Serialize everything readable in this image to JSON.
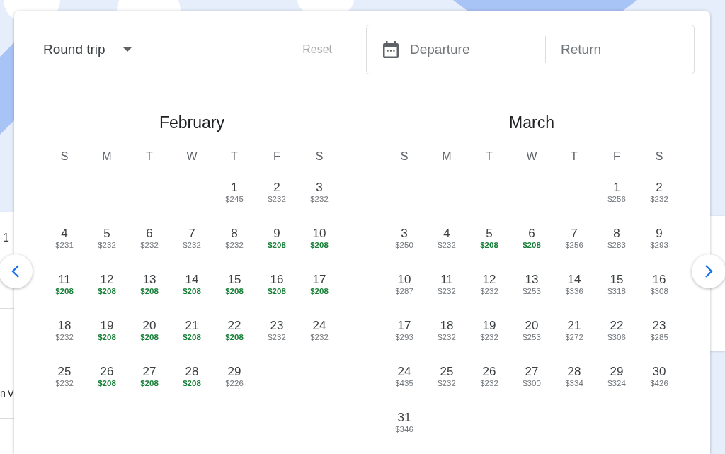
{
  "background": {
    "fragments": [
      "1",
      "n V"
    ]
  },
  "header": {
    "trip_type": "Round trip",
    "reset": {
      "label": "Reset",
      "disabled": true
    },
    "dates": {
      "departure_placeholder": "Departure",
      "return_placeholder": "Return"
    }
  },
  "months": [
    {
      "name": "February",
      "weekdays": [
        "S",
        "M",
        "T",
        "W",
        "T",
        "F",
        "S"
      ],
      "days": [
        {
          "kind": "blank"
        },
        {
          "kind": "blank"
        },
        {
          "kind": "blank"
        },
        {
          "kind": "blank"
        },
        {
          "kind": "day",
          "day": "1",
          "price": "$245",
          "lowest": false
        },
        {
          "kind": "day",
          "day": "2",
          "price": "$232",
          "lowest": false
        },
        {
          "kind": "day",
          "day": "3",
          "price": "$232",
          "lowest": false
        },
        {
          "kind": "day",
          "day": "4",
          "price": "$231",
          "lowest": false
        },
        {
          "kind": "day",
          "day": "5",
          "price": "$232",
          "lowest": false
        },
        {
          "kind": "day",
          "day": "6",
          "price": "$232",
          "lowest": false
        },
        {
          "kind": "day",
          "day": "7",
          "price": "$232",
          "lowest": false
        },
        {
          "kind": "day",
          "day": "8",
          "price": "$232",
          "lowest": false
        },
        {
          "kind": "day",
          "day": "9",
          "price": "$208",
          "lowest": true
        },
        {
          "kind": "day",
          "day": "10",
          "price": "$208",
          "lowest": true
        },
        {
          "kind": "day",
          "day": "11",
          "price": "$208",
          "lowest": true
        },
        {
          "kind": "day",
          "day": "12",
          "price": "$208",
          "lowest": true
        },
        {
          "kind": "day",
          "day": "13",
          "price": "$208",
          "lowest": true
        },
        {
          "kind": "day",
          "day": "14",
          "price": "$208",
          "lowest": true
        },
        {
          "kind": "day",
          "day": "15",
          "price": "$208",
          "lowest": true
        },
        {
          "kind": "day",
          "day": "16",
          "price": "$208",
          "lowest": true
        },
        {
          "kind": "day",
          "day": "17",
          "price": "$208",
          "lowest": true
        },
        {
          "kind": "day",
          "day": "18",
          "price": "$232",
          "lowest": false
        },
        {
          "kind": "day",
          "day": "19",
          "price": "$208",
          "lowest": true
        },
        {
          "kind": "day",
          "day": "20",
          "price": "$208",
          "lowest": true
        },
        {
          "kind": "day",
          "day": "21",
          "price": "$208",
          "lowest": true
        },
        {
          "kind": "day",
          "day": "22",
          "price": "$208",
          "lowest": true
        },
        {
          "kind": "day",
          "day": "23",
          "price": "$232",
          "lowest": false
        },
        {
          "kind": "day",
          "day": "24",
          "price": "$232",
          "lowest": false
        },
        {
          "kind": "day",
          "day": "25",
          "price": "$232",
          "lowest": false
        },
        {
          "kind": "day",
          "day": "26",
          "price": "$208",
          "lowest": true
        },
        {
          "kind": "day",
          "day": "27",
          "price": "$208",
          "lowest": true
        },
        {
          "kind": "day",
          "day": "28",
          "price": "$208",
          "lowest": true
        },
        {
          "kind": "day",
          "day": "29",
          "price": "$226",
          "lowest": false
        }
      ]
    },
    {
      "name": "March",
      "weekdays": [
        "S",
        "M",
        "T",
        "W",
        "T",
        "F",
        "S"
      ],
      "days": [
        {
          "kind": "blank"
        },
        {
          "kind": "blank"
        },
        {
          "kind": "blank"
        },
        {
          "kind": "blank"
        },
        {
          "kind": "blank"
        },
        {
          "kind": "day",
          "day": "1",
          "price": "$256",
          "lowest": false
        },
        {
          "kind": "day",
          "day": "2",
          "price": "$232",
          "lowest": false
        },
        {
          "kind": "day",
          "day": "3",
          "price": "$250",
          "lowest": false
        },
        {
          "kind": "day",
          "day": "4",
          "price": "$232",
          "lowest": false
        },
        {
          "kind": "day",
          "day": "5",
          "price": "$208",
          "lowest": true
        },
        {
          "kind": "day",
          "day": "6",
          "price": "$208",
          "lowest": true
        },
        {
          "kind": "day",
          "day": "7",
          "price": "$256",
          "lowest": false
        },
        {
          "kind": "day",
          "day": "8",
          "price": "$283",
          "lowest": false
        },
        {
          "kind": "day",
          "day": "9",
          "price": "$293",
          "lowest": false
        },
        {
          "kind": "day",
          "day": "10",
          "price": "$287",
          "lowest": false
        },
        {
          "kind": "day",
          "day": "11",
          "price": "$232",
          "lowest": false
        },
        {
          "kind": "day",
          "day": "12",
          "price": "$232",
          "lowest": false
        },
        {
          "kind": "day",
          "day": "13",
          "price": "$253",
          "lowest": false
        },
        {
          "kind": "day",
          "day": "14",
          "price": "$336",
          "lowest": false
        },
        {
          "kind": "day",
          "day": "15",
          "price": "$318",
          "lowest": false
        },
        {
          "kind": "day",
          "day": "16",
          "price": "$308",
          "lowest": false
        },
        {
          "kind": "day",
          "day": "17",
          "price": "$293",
          "lowest": false
        },
        {
          "kind": "day",
          "day": "18",
          "price": "$232",
          "lowest": false
        },
        {
          "kind": "day",
          "day": "19",
          "price": "$232",
          "lowest": false
        },
        {
          "kind": "day",
          "day": "20",
          "price": "$253",
          "lowest": false
        },
        {
          "kind": "day",
          "day": "21",
          "price": "$272",
          "lowest": false
        },
        {
          "kind": "day",
          "day": "22",
          "price": "$306",
          "lowest": false
        },
        {
          "kind": "day",
          "day": "23",
          "price": "$285",
          "lowest": false
        },
        {
          "kind": "day",
          "day": "24",
          "price": "$435",
          "lowest": false
        },
        {
          "kind": "day",
          "day": "25",
          "price": "$232",
          "lowest": false
        },
        {
          "kind": "day",
          "day": "26",
          "price": "$232",
          "lowest": false
        },
        {
          "kind": "day",
          "day": "27",
          "price": "$300",
          "lowest": false
        },
        {
          "kind": "day",
          "day": "28",
          "price": "$334",
          "lowest": false
        },
        {
          "kind": "day",
          "day": "29",
          "price": "$324",
          "lowest": false
        },
        {
          "kind": "day",
          "day": "30",
          "price": "$426",
          "lowest": false
        },
        {
          "kind": "day",
          "day": "31",
          "price": "$346",
          "lowest": false
        }
      ]
    }
  ]
}
